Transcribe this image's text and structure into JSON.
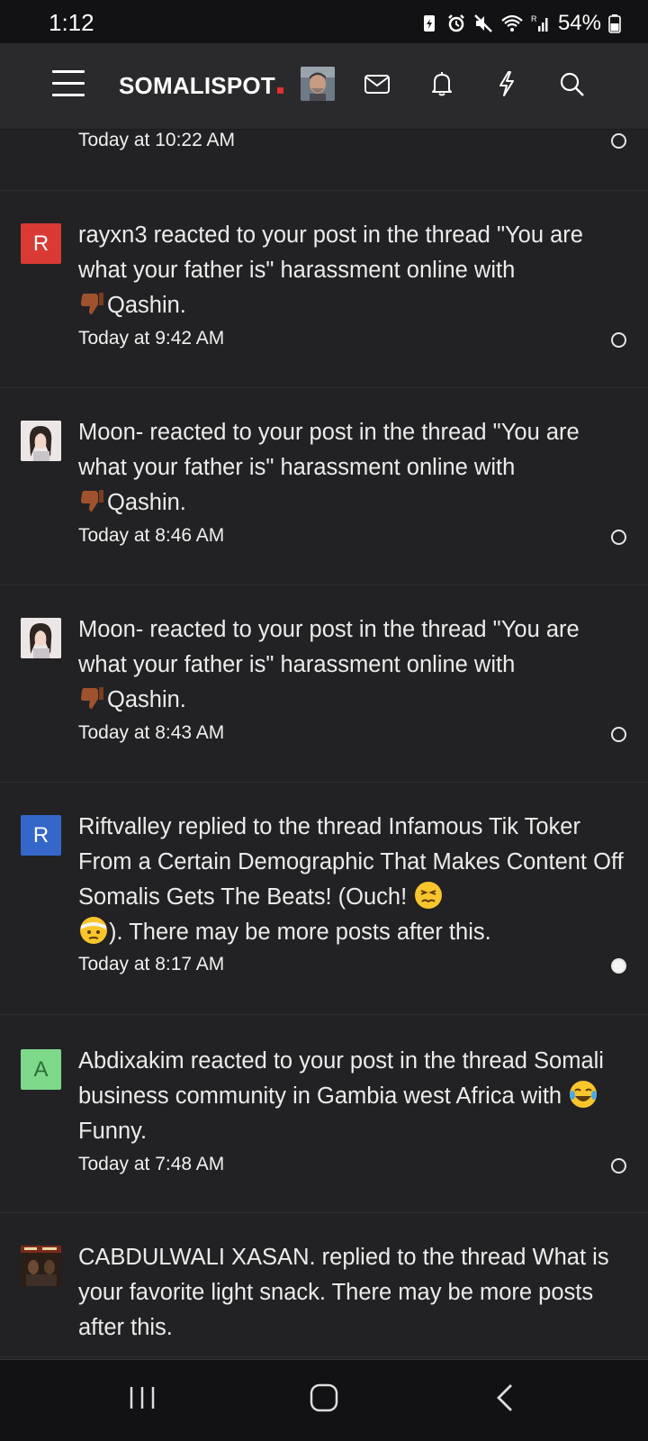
{
  "status_bar": {
    "time": "1:12",
    "battery": "54%"
  },
  "header": {
    "logo_text": "SOMALISPOT"
  },
  "notifications": [
    {
      "text": "",
      "time": "Today at 10:22 AM",
      "read": false
    },
    {
      "avatar_letter": "R",
      "avatar_color": "#d93a34",
      "user": "rayxn3",
      "text": "rayxn3 reacted to your post in the thread \"You are what your father is\" harassment online with",
      "reaction": "Qashin.",
      "time": "Today at 9:42 AM",
      "read": false
    },
    {
      "user": "Moon-",
      "text": "Moon- reacted to your post in the thread \"You are what your father is\" harassment online with",
      "reaction": "Qashin.",
      "time": "Today at 8:46 AM",
      "read": false
    },
    {
      "user": "Moon-",
      "text": "Moon- reacted to your post in the thread \"You are what your father is\" harassment online with",
      "reaction": "Qashin.",
      "time": "Today at 8:43 AM",
      "read": false
    },
    {
      "avatar_letter": "R",
      "avatar_color": "#3467c9",
      "user": "Riftvalley",
      "text_part1": "Riftvalley replied to the thread Infamous Tik Toker From a Certain Demographic That Makes Content Off Somalis Gets The Beats! (Ouch!",
      "text_part2": "). There may be more posts after this.",
      "time": "Today at 8:17 AM",
      "read": true
    },
    {
      "avatar_letter": "A",
      "avatar_color": "#7ed88a",
      "user": "Abdixakim",
      "text": "Abdixakim reacted to your post in the thread Somali business community in Gambia west Africa with",
      "reaction": "Funny.",
      "time": "Today at 7:48 AM",
      "read": false
    },
    {
      "user": "CABDULWALI XASAN.",
      "text": "CABDULWALI XASAN. replied to the thread What is your favorite light snack. There may be more posts after this.",
      "time": "",
      "read": false
    }
  ]
}
